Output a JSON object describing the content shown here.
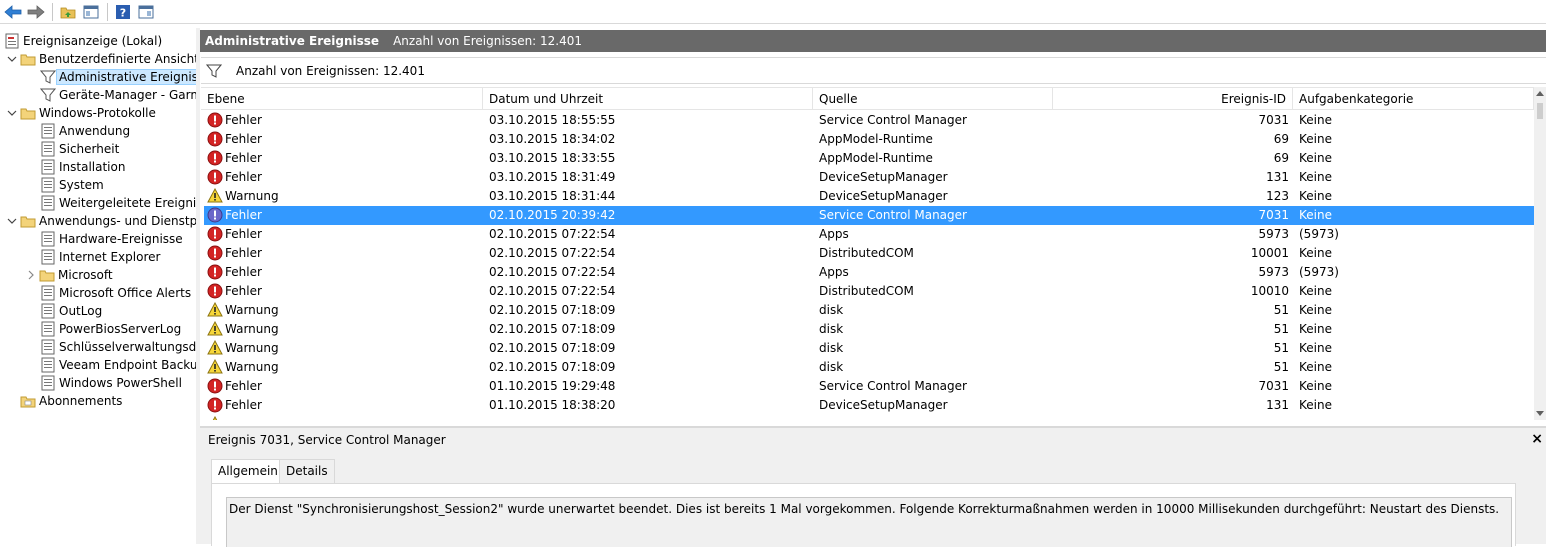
{
  "toolbar": {
    "buttons": [
      "back-icon",
      "forward-icon",
      "folder-up-icon",
      "show-hide-tree-icon",
      "help-icon",
      "action-pane-icon"
    ]
  },
  "tree": {
    "root": "Ereignisanzeige (Lokal)",
    "custom_views": "Benutzerdefinierte Ansichten",
    "custom_view_admin": "Administrative Ereignisse",
    "custom_view_devices": "Geräte-Manager - Garmin",
    "windows_logs": "Windows-Protokolle",
    "wl_application": "Anwendung",
    "wl_security": "Sicherheit",
    "wl_setup": "Installation",
    "wl_system": "System",
    "wl_forwarded": "Weitergeleitete Ereignisse",
    "app_service_logs": "Anwendungs- und Dienstprotokolle",
    "as_hardware": "Hardware-Ereignisse",
    "as_ie": "Internet Explorer",
    "as_microsoft": "Microsoft",
    "as_office": "Microsoft Office Alerts",
    "as_outlog": "OutLog",
    "as_powerbios": "PowerBiosServerLog",
    "as_keymgmt": "Schlüsselverwaltungsdienst",
    "as_veeam": "Veeam Endpoint Backup",
    "as_powershell": "Windows PowerShell",
    "subscriptions": "Abonnements"
  },
  "header": {
    "title": "Administrative Ereignisse",
    "count": "Anzahl von Ereignissen: 12.401"
  },
  "filter": {
    "text": "Anzahl von Ereignissen: 12.401"
  },
  "columns": {
    "level": "Ebene",
    "datetime": "Datum und Uhrzeit",
    "source": "Quelle",
    "event_id": "Ereignis-ID",
    "task": "Aufgabenkategorie"
  },
  "events": [
    {
      "icon": "error-icon",
      "level": "Fehler",
      "datetime": "03.10.2015 18:55:55",
      "source": "Service Control Manager",
      "event_id": "7031",
      "task": "Keine"
    },
    {
      "icon": "error-icon",
      "level": "Fehler",
      "datetime": "03.10.2015 18:34:02",
      "source": "AppModel-Runtime",
      "event_id": "69",
      "task": "Keine"
    },
    {
      "icon": "error-icon",
      "level": "Fehler",
      "datetime": "03.10.2015 18:33:55",
      "source": "AppModel-Runtime",
      "event_id": "69",
      "task": "Keine"
    },
    {
      "icon": "error-icon",
      "level": "Fehler",
      "datetime": "03.10.2015 18:31:49",
      "source": "DeviceSetupManager",
      "event_id": "131",
      "task": "Keine"
    },
    {
      "icon": "warning-icon",
      "level": "Warnung",
      "datetime": "03.10.2015 18:31:44",
      "source": "DeviceSetupManager",
      "event_id": "123",
      "task": "Keine"
    },
    {
      "icon": "error-icon",
      "level": "Fehler",
      "datetime": "02.10.2015 20:39:42",
      "source": "Service Control Manager",
      "event_id": "7031",
      "task": "Keine",
      "selected": true
    },
    {
      "icon": "error-icon",
      "level": "Fehler",
      "datetime": "02.10.2015 07:22:54",
      "source": "Apps",
      "event_id": "5973",
      "task": "(5973)"
    },
    {
      "icon": "error-icon",
      "level": "Fehler",
      "datetime": "02.10.2015 07:22:54",
      "source": "DistributedCOM",
      "event_id": "10001",
      "task": "Keine"
    },
    {
      "icon": "error-icon",
      "level": "Fehler",
      "datetime": "02.10.2015 07:22:54",
      "source": "Apps",
      "event_id": "5973",
      "task": "(5973)"
    },
    {
      "icon": "error-icon",
      "level": "Fehler",
      "datetime": "02.10.2015 07:22:54",
      "source": "DistributedCOM",
      "event_id": "10010",
      "task": "Keine"
    },
    {
      "icon": "warning-icon",
      "level": "Warnung",
      "datetime": "02.10.2015 07:18:09",
      "source": "disk",
      "event_id": "51",
      "task": "Keine"
    },
    {
      "icon": "warning-icon",
      "level": "Warnung",
      "datetime": "02.10.2015 07:18:09",
      "source": "disk",
      "event_id": "51",
      "task": "Keine"
    },
    {
      "icon": "warning-icon",
      "level": "Warnung",
      "datetime": "02.10.2015 07:18:09",
      "source": "disk",
      "event_id": "51",
      "task": "Keine"
    },
    {
      "icon": "warning-icon",
      "level": "Warnung",
      "datetime": "02.10.2015 07:18:09",
      "source": "disk",
      "event_id": "51",
      "task": "Keine"
    },
    {
      "icon": "error-icon",
      "level": "Fehler",
      "datetime": "01.10.2015 19:29:48",
      "source": "Service Control Manager",
      "event_id": "7031",
      "task": "Keine"
    },
    {
      "icon": "error-icon",
      "level": "Fehler",
      "datetime": "01.10.2015 18:38:20",
      "source": "DeviceSetupManager",
      "event_id": "131",
      "task": "Keine"
    }
  ],
  "detail": {
    "title": "Ereignis 7031, Service Control Manager",
    "close": "×",
    "tab_general": "Allgemein",
    "tab_details": "Details",
    "message": "Der Dienst \"Synchronisierungshost_Session2\" wurde unerwartet beendet. Dies ist bereits 1 Mal vorgekommen. Folgende Korrekturmaßnahmen werden in 10000 Millisekunden durchgeführt: Neustart des Diensts."
  }
}
